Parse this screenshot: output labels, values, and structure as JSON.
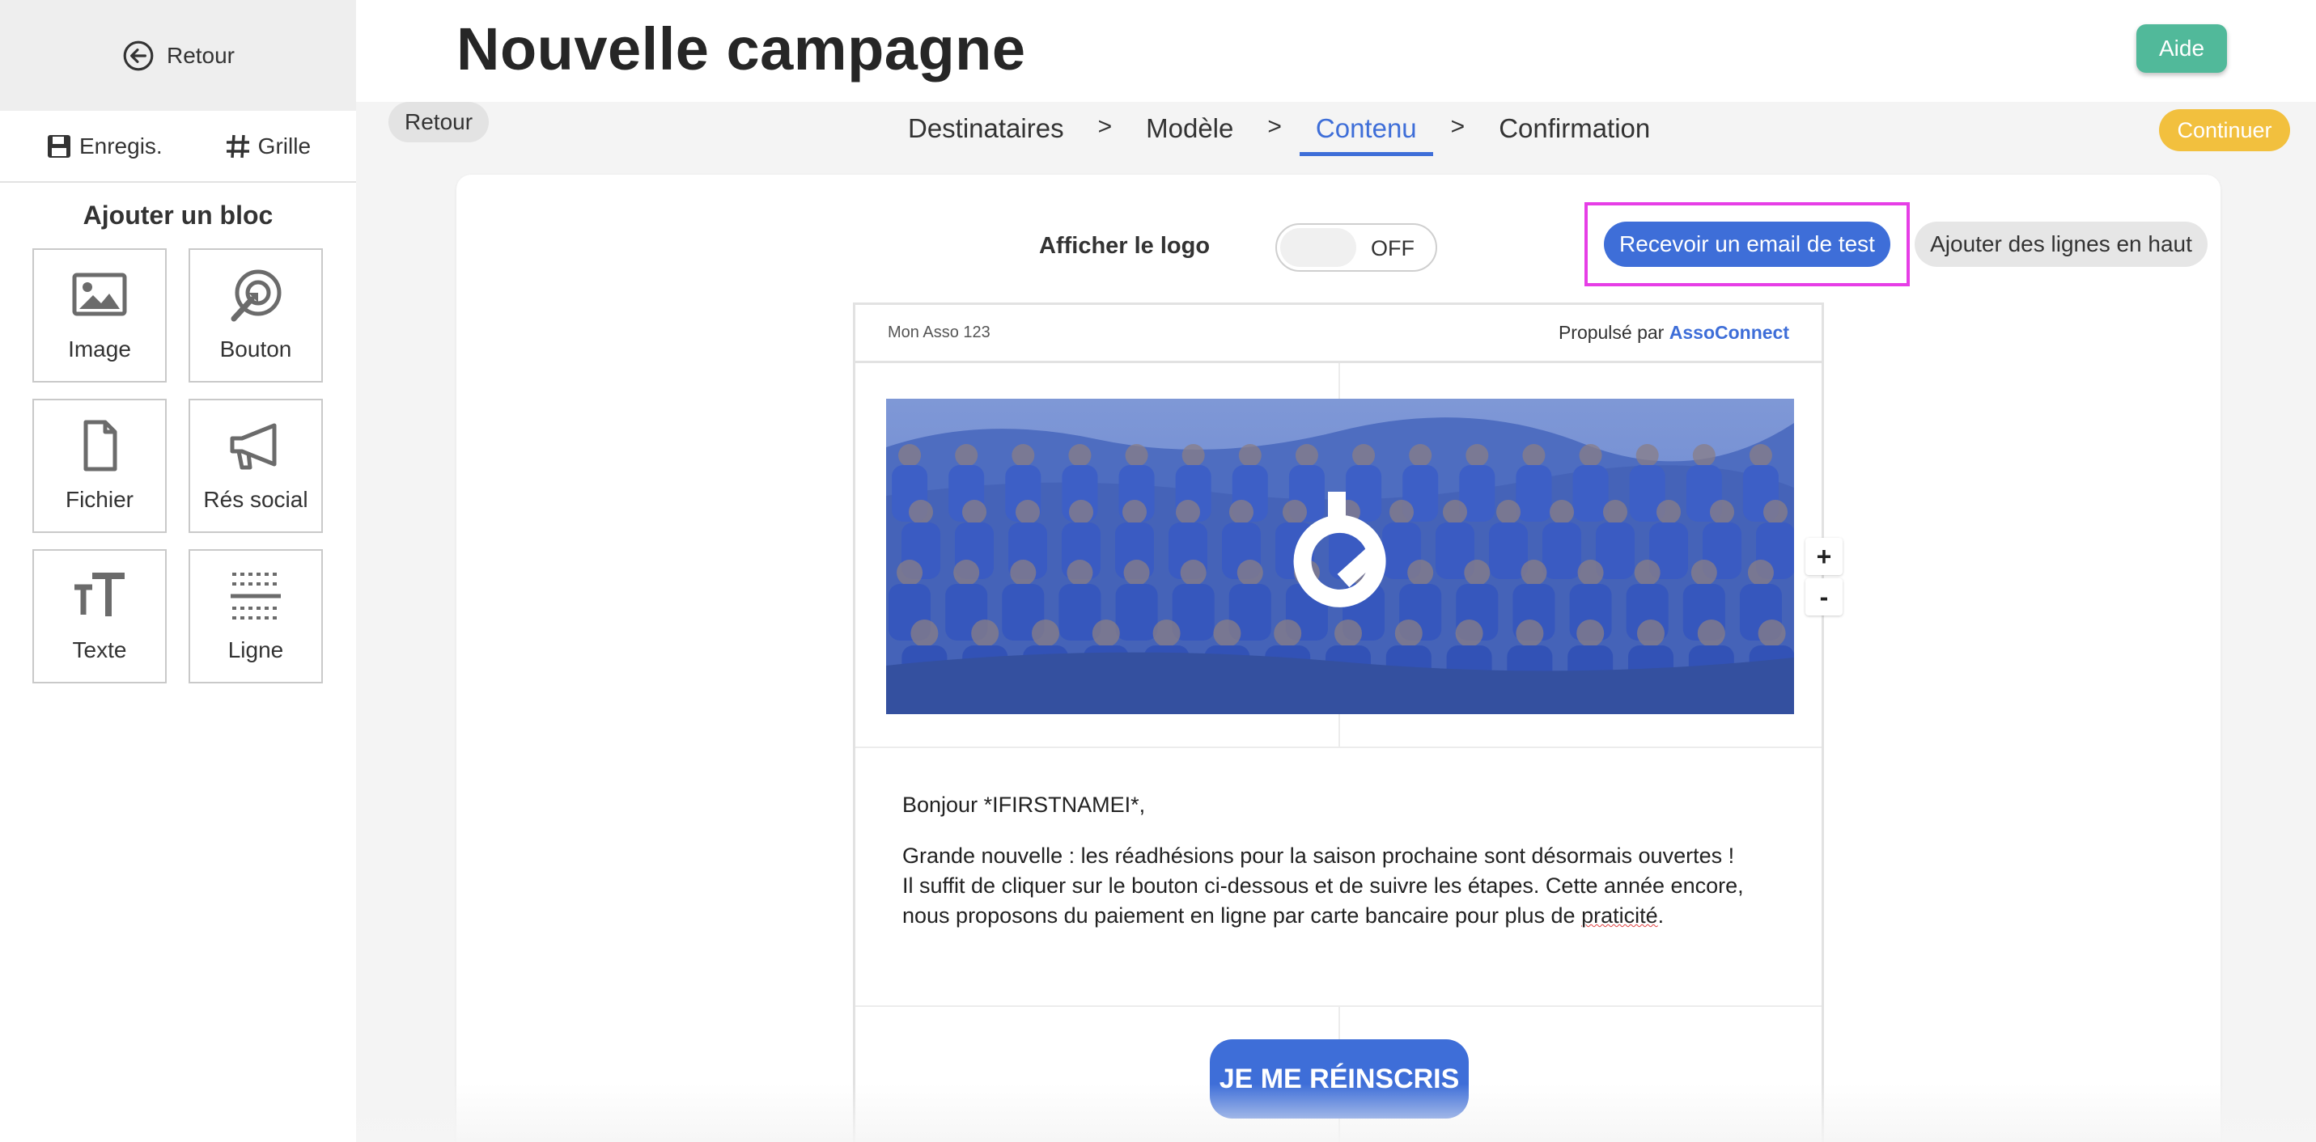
{
  "sidebar": {
    "back_label": "Retour",
    "save_label": "Enregis.",
    "grid_label": "Grille",
    "add_block_title": "Ajouter un bloc",
    "blocks": [
      {
        "label": "Image",
        "icon": "image-icon"
      },
      {
        "label": "Bouton",
        "icon": "button-target-icon"
      },
      {
        "label": "Fichier",
        "icon": "file-icon"
      },
      {
        "label": "Rés social",
        "icon": "megaphone-icon"
      },
      {
        "label": "Texte",
        "icon": "text-size-icon"
      },
      {
        "label": "Ligne",
        "icon": "line-divider-icon"
      }
    ]
  },
  "header": {
    "title": "Nouvelle campagne",
    "help_label": "Aide"
  },
  "stepper": {
    "back_label": "Retour",
    "steps": [
      "Destinataires",
      "Modèle",
      "Contenu",
      "Confirmation"
    ],
    "separator": ">",
    "active_step": "Contenu",
    "continue_label": "Continuer"
  },
  "toolbar": {
    "show_logo_label": "Afficher le logo",
    "toggle_state": "OFF",
    "test_email_label": "Recevoir un email de test",
    "add_lines_top_label": "Ajouter des lignes en haut"
  },
  "email": {
    "org_name": "Mon Asso 123",
    "powered_prefix": "Propulsé par",
    "powered_brand": "AssoConnect",
    "zoom_in": "+",
    "zoom_out": "-",
    "greeting": "Bonjour *IFIRSTNAMEI*,",
    "body_line1": "Grande nouvelle : les réadhésions pour la saison prochaine sont désormais ouvertes !",
    "body_line2": "Il suffit de cliquer sur le bouton ci-dessous et de suivre les étapes. Cette année encore,",
    "body_line3_prefix": "nous proposons du paiement en ligne par carte bancaire pour plus de ",
    "body_line3_word": "praticité",
    "body_line3_suffix": ".",
    "cta_label": "JE ME RÉINSCRIS"
  },
  "colors": {
    "accent": "#3e6ed8",
    "help": "#51b99a",
    "continue": "#f2c03e",
    "highlight_outline": "#e63ee6"
  }
}
